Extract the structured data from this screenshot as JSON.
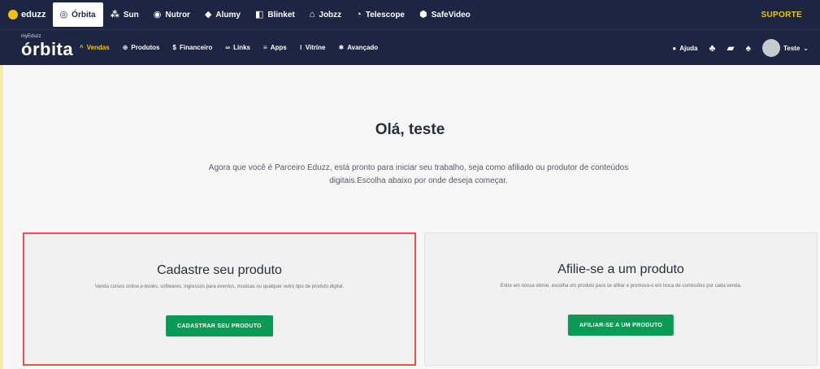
{
  "topbar": {
    "items": [
      {
        "label": "eduzz",
        "icon": "eduzz-logo-icon",
        "active": false
      },
      {
        "label": "Órbita",
        "icon": "orbita-icon",
        "active": true
      },
      {
        "label": "Sun",
        "icon": "sun-icon",
        "active": false
      },
      {
        "label": "Nutror",
        "icon": "nutror-icon",
        "active": false
      },
      {
        "label": "Alumy",
        "icon": "alumy-icon",
        "active": false
      },
      {
        "label": "Blinket",
        "icon": "blinket-icon",
        "active": false
      },
      {
        "label": "Jobzz",
        "icon": "jobzz-icon",
        "active": false
      },
      {
        "label": "Telescope",
        "icon": "telescope-icon",
        "active": false
      },
      {
        "label": "SafeVideo",
        "icon": "safevideo-icon",
        "active": false
      }
    ],
    "support_label": "SUPORTE",
    "accent": "#f6c10a"
  },
  "navbar": {
    "brand_small": "myEduzz",
    "brand_big": "órbita",
    "items": [
      {
        "label": "Vendas",
        "icon": "chevron-icon",
        "active": true
      },
      {
        "label": "Produtos",
        "icon": "products-icon",
        "active": false
      },
      {
        "label": "Financeiro",
        "icon": "finance-icon",
        "active": false
      },
      {
        "label": "Links",
        "icon": "links-icon",
        "active": false
      },
      {
        "label": "Apps",
        "icon": "apps-icon",
        "active": false
      },
      {
        "label": "Vitrine",
        "icon": "vitrine-icon",
        "active": false
      },
      {
        "label": "Avançado",
        "icon": "advanced-icon",
        "active": false
      }
    ],
    "help_label": "Ajuda",
    "user_label": "Teste"
  },
  "main": {
    "title": "Olá, teste",
    "intro": "Agora que você é Parceiro Eduzz, está pronto para iniciar seu trabalho, seja como afiliado ou produtor de conteúdos digitais.Escolha abaixo por onde deseja começar."
  },
  "cards": {
    "producer": {
      "title": "Cadastre seu produto",
      "description": "Venda cursos online,e-books, softwares, ingressos para eventos, musicas ou qualquer outro tipo de produto digital.",
      "button": "CADASTRAR SEU PRODUTO"
    },
    "affiliate": {
      "title": "Afilie-se a um produto",
      "description": "Entre em nossa vitrine, escolha um produto para se afiliar e promova-o em troca de comissões por cada venda.",
      "button": "AFILIAR-SE A UM PRODUTO"
    }
  },
  "colors": {
    "nav_bg": "#1c2541",
    "button_green": "#0a9a54",
    "highlight_red": "#ef4e4e"
  }
}
